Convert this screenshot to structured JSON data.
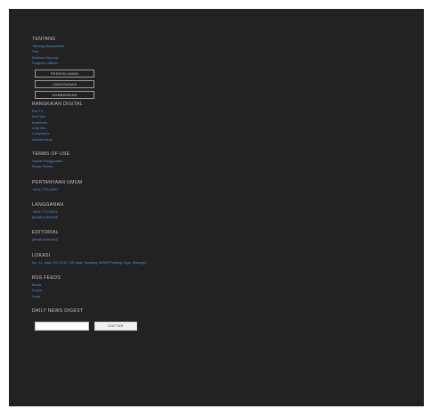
{
  "tentang": {
    "heading": "TENTANG",
    "links": [
      "Tentang Malaysiakini",
      "Staf",
      "Iklankan Kepong",
      "Program Latihan"
    ],
    "buttons": [
      "PENGIKLANAN",
      "LANGGANAN",
      "SUMBANGAN"
    ]
  },
  "rangkaian": {
    "heading": "RANGKAIAN DIGITAL",
    "links": [
      "Kini TV",
      "KiniTube",
      "KiniMedia",
      "Undi.info",
      "Complaints",
      "Markini News"
    ]
  },
  "terms": {
    "heading": "TERMS OF USE",
    "links": [
      "Syarat Penggunaan",
      "Dasar Privasi"
    ]
  },
  "pertanyaan": {
    "heading": "PERTANYAAN UMUM",
    "links": [
      "+603-7770-0000"
    ]
  },
  "langganan": {
    "heading": "LANGGANAN",
    "links": [
      "+603-7770-0021",
      "[email protected]"
    ]
  },
  "editorial": {
    "heading": "EDITORIAL",
    "links": [
      "[email protected]"
    ]
  },
  "lokasi": {
    "heading": "LOKASI",
    "links": [
      "No. 11, Jalan SS 20/11, Off Jalan Tandang, 46050 Petaling Jaya, Selangor"
    ]
  },
  "rss": {
    "heading": "RSS FEEDS",
    "links": [
      "Berita",
      "Kolum",
      "Surat"
    ]
  },
  "digest": {
    "heading": "DAILY NEWS DIGEST",
    "email_value": "",
    "submit_label": "DAFTAR"
  },
  "colors": {
    "background": "#222222",
    "link": "#4f8fd6",
    "heading": "#c4c4c4"
  }
}
